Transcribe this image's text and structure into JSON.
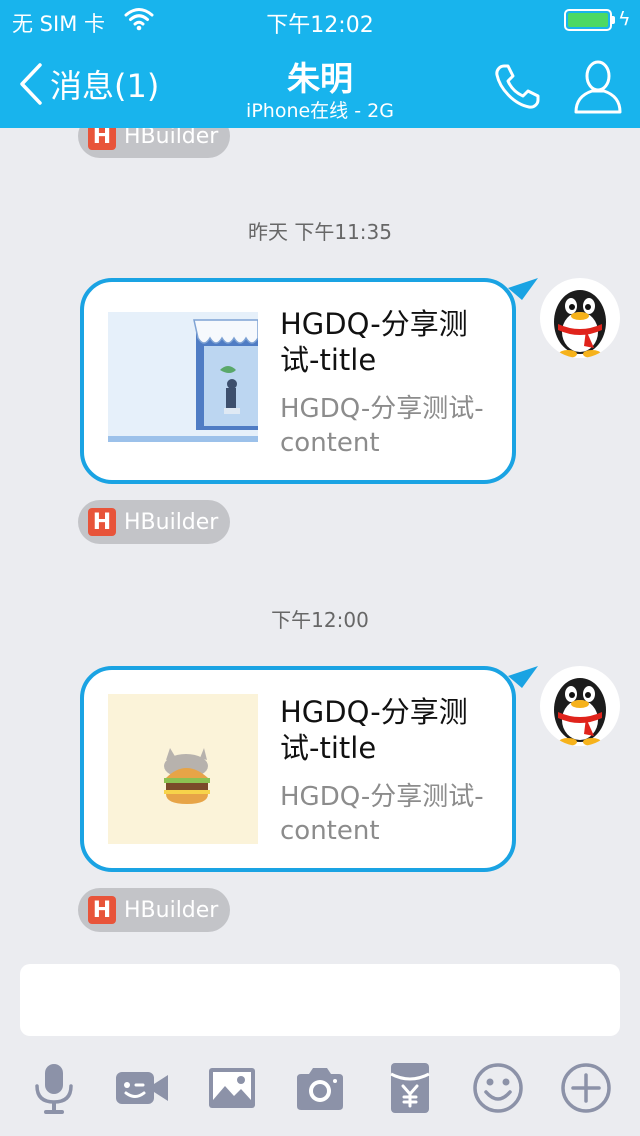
{
  "status_bar": {
    "carrier": "无 SIM 卡",
    "time": "下午12:02",
    "battery_level": 1.0
  },
  "nav": {
    "back_label": "消息(1)",
    "title": "朱明",
    "subtitle": "iPhone在线 - 2G"
  },
  "messages": [
    {
      "time": "昨天 下午11:35",
      "card_title": "HGDQ-分享测试-title",
      "card_desc": "HGDQ-分享测试-content",
      "source": "HBuilder"
    },
    {
      "time": "下午12:00",
      "card_title": "HGDQ-分享测试-title",
      "card_desc": "HGDQ-分享测试-content",
      "source": "HBuilder"
    }
  ],
  "partial_source": "HBuilder",
  "toolbar_icons": [
    "microphone-icon",
    "video-call-icon",
    "image-icon",
    "camera-icon",
    "red-packet-icon",
    "emoji-icon",
    "plus-icon"
  ],
  "colors": {
    "accent": "#18b4ed",
    "bubble_border": "#1aa3e3",
    "background": "#ebecf0",
    "toolbar_icon": "#8c92a8",
    "source_chip": "#c3c4c8"
  }
}
